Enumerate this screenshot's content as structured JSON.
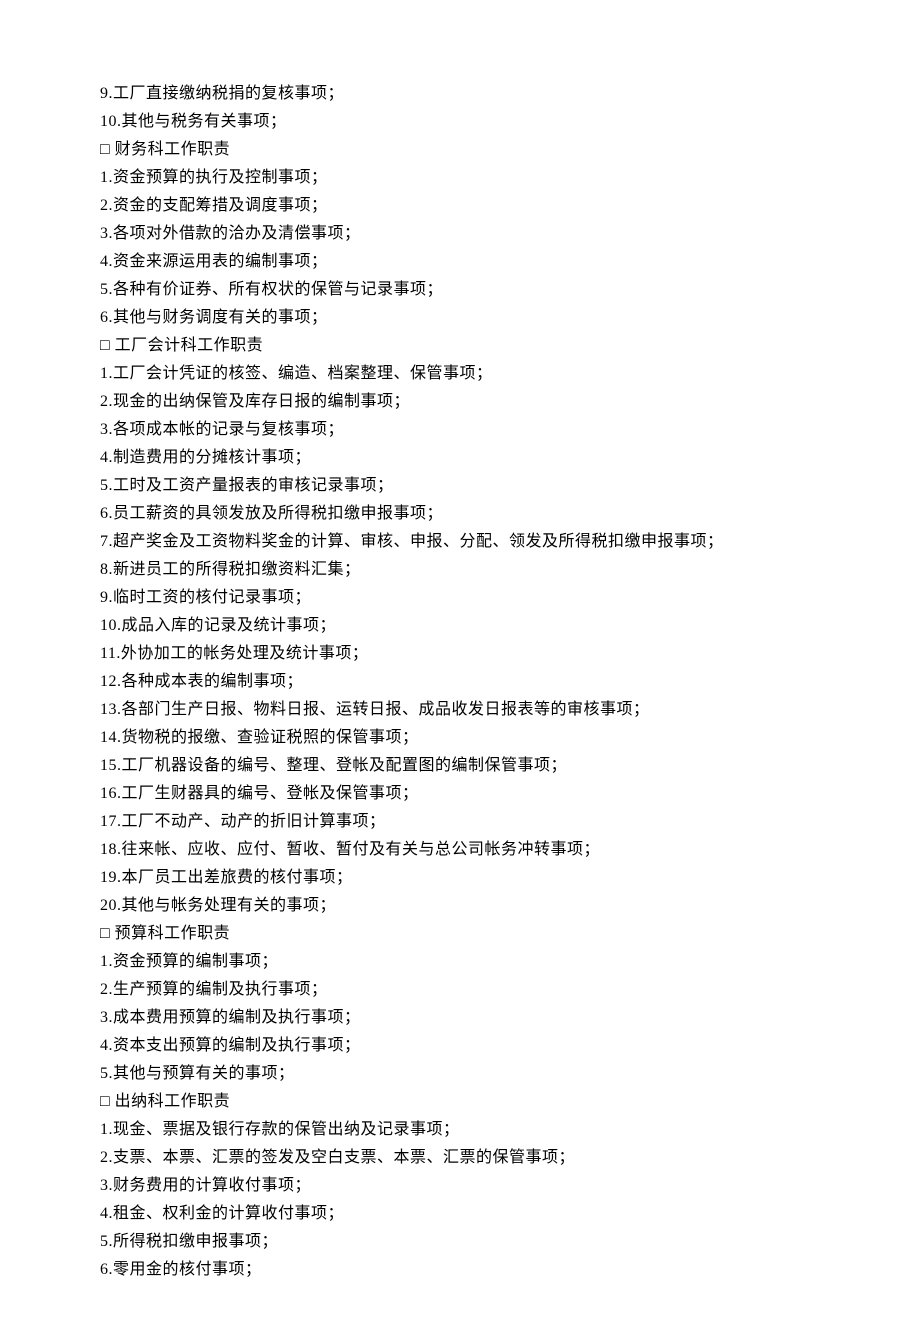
{
  "lines": [
    "9.工厂直接缴纳税捐的复核事项；",
    "10.其他与税务有关事项；",
    "□ 财务科工作职责",
    "1.资金预算的执行及控制事项；",
    "2.资金的支配筹措及调度事项；",
    "3.各项对外借款的洽办及清偿事项；",
    "4.资金来源运用表的编制事项；",
    "5.各种有价证券、所有权状的保管与记录事项；",
    "6.其他与财务调度有关的事项；",
    "□ 工厂会计科工作职责",
    "1.工厂会计凭证的核签、编造、档案整理、保管事项；",
    "2.现金的出纳保管及库存日报的编制事项；",
    "3.各项成本帐的记录与复核事项；",
    "4.制造费用的分摊核计事项；",
    "5.工时及工资产量报表的审核记录事项；",
    "6.员工薪资的具领发放及所得税扣缴申报事项；",
    "7.超产奖金及工资物料奖金的计算、审核、申报、分配、领发及所得税扣缴申报事项；",
    "8.新进员工的所得税扣缴资料汇集；",
    "9.临时工资的核付记录事项；",
    "10.成品入库的记录及统计事项；",
    "11.外协加工的帐务处理及统计事项；",
    "12.各种成本表的编制事项；",
    "13.各部门生产日报、物料日报、运转日报、成品收发日报表等的审核事项；",
    "14.货物税的报缴、查验证税照的保管事项；",
    "15.工厂机器设备的编号、整理、登帐及配置图的编制保管事项；",
    "16.工厂生财器具的编号、登帐及保管事项；",
    "17.工厂不动产、动产的折旧计算事项；",
    "18.往来帐、应收、应付、暂收、暂付及有关与总公司帐务冲转事项；",
    "19.本厂员工出差旅费的核付事项；",
    "20.其他与帐务处理有关的事项；",
    "□ 预算科工作职责",
    "1.资金预算的编制事项；",
    "2.生产预算的编制及执行事项；",
    "3.成本费用预算的编制及执行事项；",
    "4.资本支出预算的编制及执行事项；",
    "5.其他与预算有关的事项；",
    "□ 出纳科工作职责",
    "1.现金、票据及银行存款的保管出纳及记录事项；",
    "2.支票、本票、汇票的签发及空白支票、本票、汇票的保管事项；",
    "3.财务费用的计算收付事项；",
    "4.租金、权利金的计算收付事项；",
    "5.所得税扣缴申报事项；",
    "6.零用金的核付事项；"
  ]
}
